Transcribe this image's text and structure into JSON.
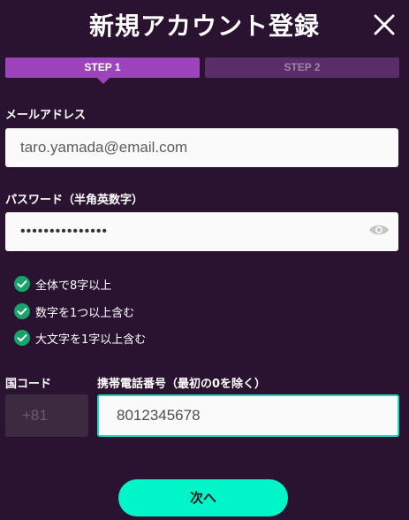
{
  "header": {
    "title": "新規アカウント登録"
  },
  "steps": [
    {
      "label": "STEP 1",
      "active": true
    },
    {
      "label": "STEP 2",
      "active": false
    }
  ],
  "email": {
    "label": "メールアドレス",
    "value": "taro.yamada@email.com"
  },
  "password": {
    "label": "パスワード（半角英数字）",
    "masked_value": "•••••••••••••••"
  },
  "password_rules": [
    {
      "text": "全体で8字以上",
      "met": true
    },
    {
      "text": "数字を1つ以上含む",
      "met": true
    },
    {
      "text": "大文字を1字以上含む",
      "met": true
    }
  ],
  "country_code": {
    "label": "国コード",
    "value": "+81"
  },
  "phone": {
    "label": "携帯電話番号（最初の0を除く）",
    "value": "8012345678"
  },
  "next_button": {
    "label": "次へ"
  },
  "colors": {
    "background": "#2a1330",
    "step_active": "#9d44bd",
    "step_inactive": "#5a2d68",
    "accent": "#00f5c8",
    "check": "#17a36a"
  }
}
